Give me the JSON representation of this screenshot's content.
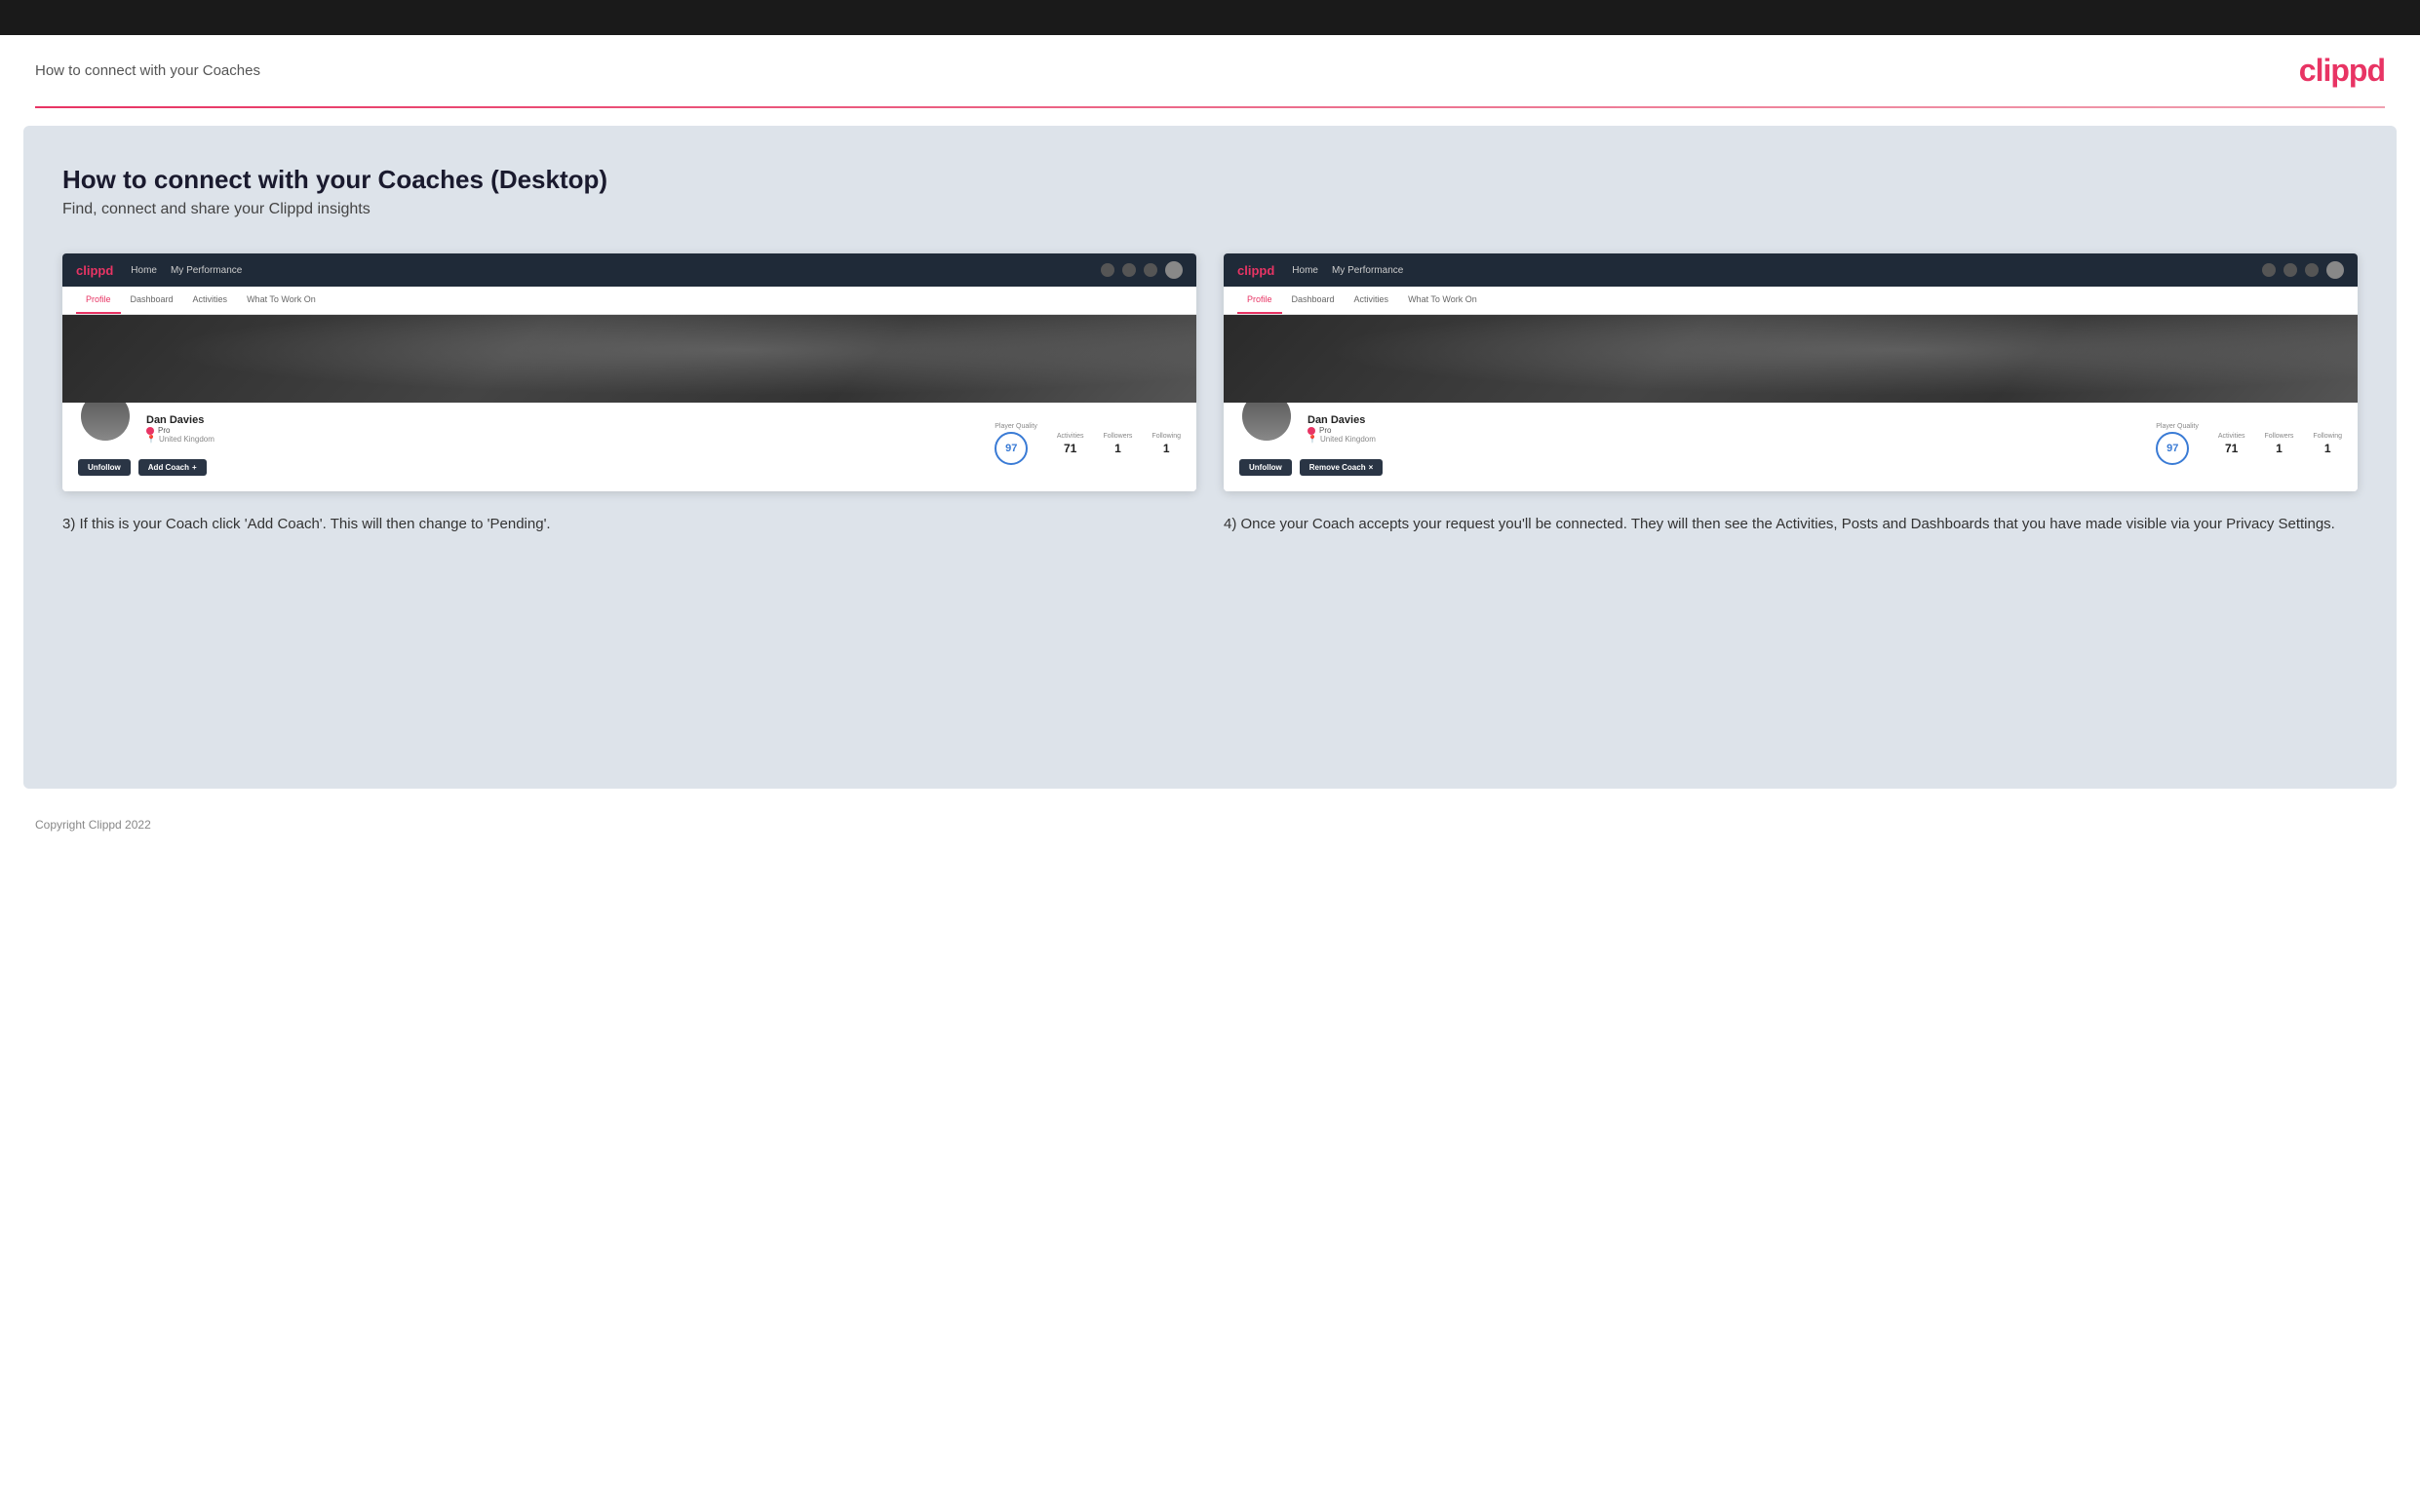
{
  "topBar": {},
  "header": {
    "title": "How to connect with your Coaches",
    "logo": "clippd"
  },
  "mainContent": {
    "heading": "How to connect with your Coaches (Desktop)",
    "subheading": "Find, connect and share your Clippd insights",
    "screenshot1": {
      "nav": {
        "logo": "clippd",
        "links": [
          "Home",
          "My Performance"
        ]
      },
      "tabs": [
        "Profile",
        "Dashboard",
        "Activities",
        "What To Work On"
      ],
      "activeTab": "Profile",
      "profile": {
        "name": "Dan Davies",
        "badge": "Pro",
        "location": "United Kingdom",
        "playerQuality": 97,
        "activities": 71,
        "followers": 1,
        "following": 1
      },
      "actions": [
        "Unfollow",
        "Add Coach +"
      ]
    },
    "screenshot2": {
      "nav": {
        "logo": "clippd",
        "links": [
          "Home",
          "My Performance"
        ]
      },
      "tabs": [
        "Profile",
        "Dashboard",
        "Activities",
        "What To Work On"
      ],
      "activeTab": "Profile",
      "profile": {
        "name": "Dan Davies",
        "badge": "Pro",
        "location": "United Kingdom",
        "playerQuality": 97,
        "activities": 71,
        "followers": 1,
        "following": 1
      },
      "actions": [
        "Unfollow",
        "Remove Coach ×"
      ]
    },
    "description1": "3) If this is your Coach click 'Add Coach'. This will then change to 'Pending'.",
    "description2": "4) Once your Coach accepts your request you'll be connected. They will then see the Activities, Posts and Dashboards that you have made visible via your Privacy Settings."
  },
  "footer": {
    "copyright": "Copyright Clippd 2022"
  },
  "labels": {
    "playerQuality": "Player Quality",
    "activities": "Activities",
    "followers": "Followers",
    "following": "Following",
    "unfollow": "Unfollow",
    "addCoach": "Add Coach",
    "addCoachPlus": "+",
    "removeCoach": "Remove Coach",
    "removeCoachX": "×",
    "pro": "Pro",
    "unitedKingdom": "United Kingdom"
  }
}
